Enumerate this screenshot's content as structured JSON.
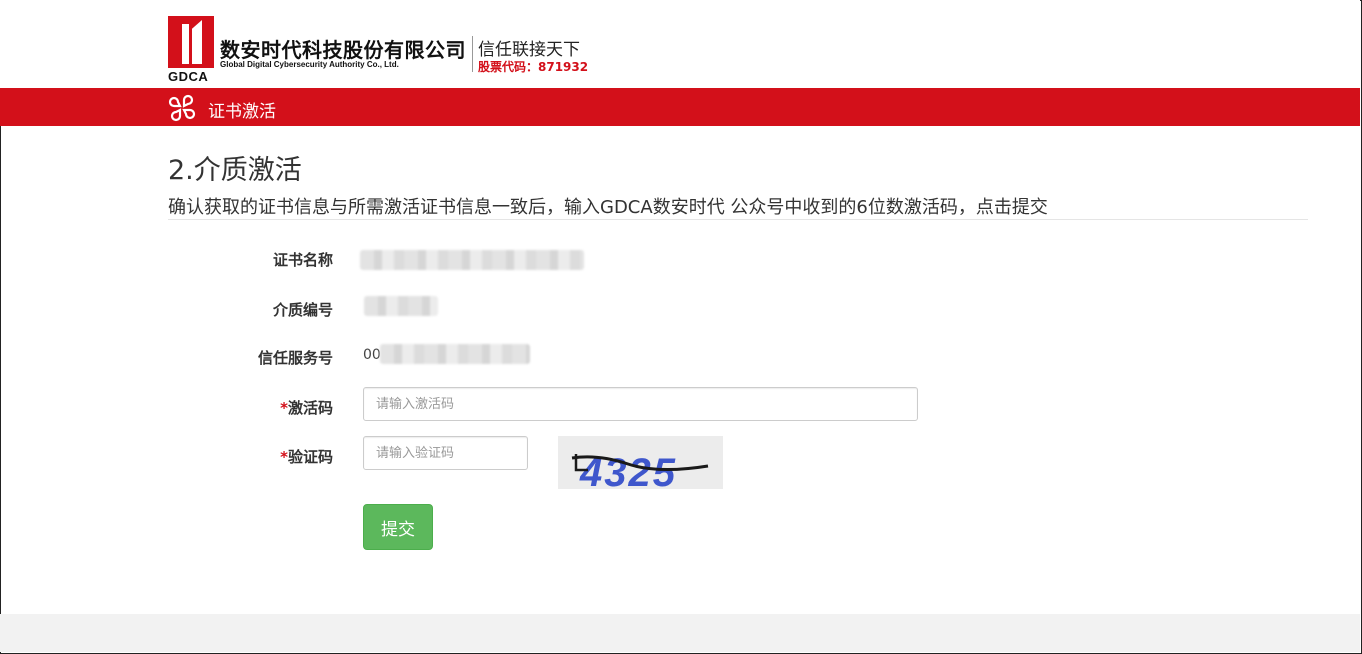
{
  "header": {
    "logo_text": "GDCA",
    "company_cn": "数安时代科技股份有限公司",
    "company_en": "Global Digital Cybersecurity Authority Co., Ltd.",
    "slogan": "信任联接天下",
    "stock_code": "股票代码：871932"
  },
  "nav": {
    "title": "证书激活",
    "icon": "clover-grid-icon"
  },
  "main": {
    "title": "2.介质激活",
    "subtitle": "确认获取的证书信息与所需激活证书信息一致后，输入GDCA数安时代 公众号中收到的6位数激活码，点击提交"
  },
  "form": {
    "cert_name_label": "证书名称",
    "medium_no_label": "介质编号",
    "trust_service_label": "信任服务号",
    "trust_service_prefix": "00",
    "required_mark": "*",
    "activation_label": "激活码",
    "activation_placeholder": "请输入激活码",
    "activation_value": "",
    "captcha_label": "验证码",
    "captcha_placeholder": "请输入验证码",
    "captcha_value": "",
    "captcha_text": "4325",
    "submit_label": "提交"
  },
  "colors": {
    "brand_red": "#d3101a",
    "submit_green": "#5cb85c"
  }
}
